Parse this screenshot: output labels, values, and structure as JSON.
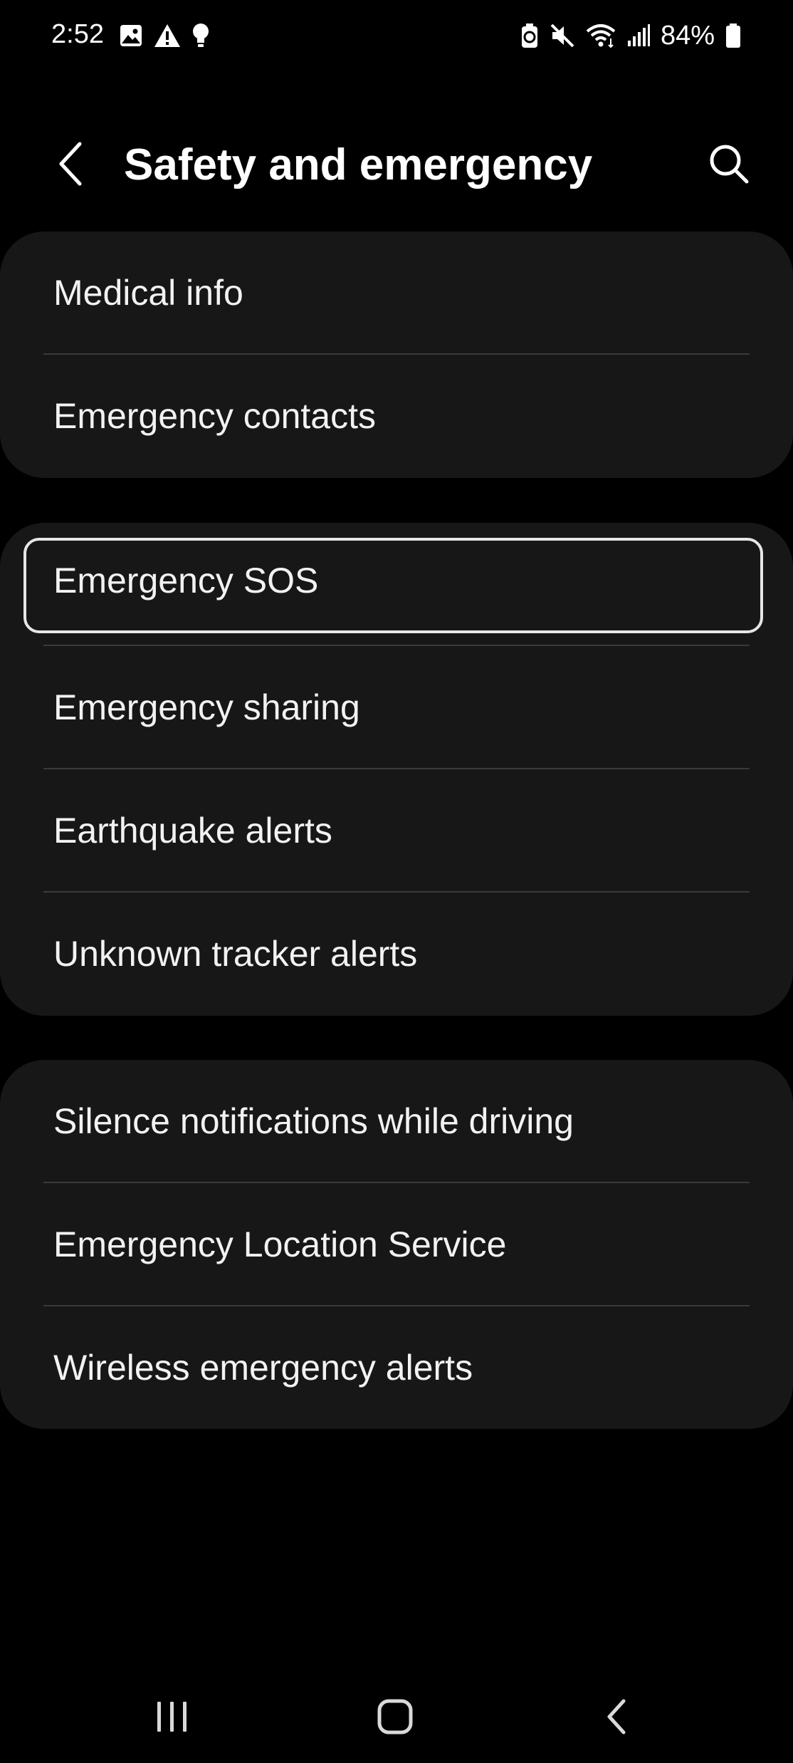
{
  "status_bar": {
    "time": "2:52",
    "battery_percent": "84%",
    "left_icons": [
      "gallery-icon",
      "warning-icon",
      "bulb-icon"
    ],
    "right_icons": [
      "battery-saver-icon",
      "mute-icon",
      "wifi-icon",
      "signal-icon",
      "battery-icon"
    ]
  },
  "header": {
    "title": "Safety and emergency",
    "back_icon": "back-arrow-icon",
    "search_icon": "search-icon"
  },
  "groups": [
    {
      "items": [
        {
          "label": "Medical info"
        },
        {
          "label": "Emergency contacts"
        }
      ]
    },
    {
      "items": [
        {
          "label": "Emergency SOS",
          "focused": true
        },
        {
          "label": "Emergency sharing"
        },
        {
          "label": "Earthquake alerts"
        },
        {
          "label": "Unknown tracker alerts"
        }
      ]
    },
    {
      "items": [
        {
          "label": "Silence notifications while driving"
        },
        {
          "label": "Emergency Location Service"
        },
        {
          "label": "Wireless emergency alerts"
        }
      ]
    }
  ],
  "nav_bar": {
    "buttons": [
      "recents-icon",
      "home-icon",
      "back-icon"
    ]
  },
  "colors": {
    "background": "#000000",
    "card": "#171717",
    "divider": "#3a3a3a",
    "text": "#f2f2f2",
    "focus_ring": "#e6e6e6"
  }
}
